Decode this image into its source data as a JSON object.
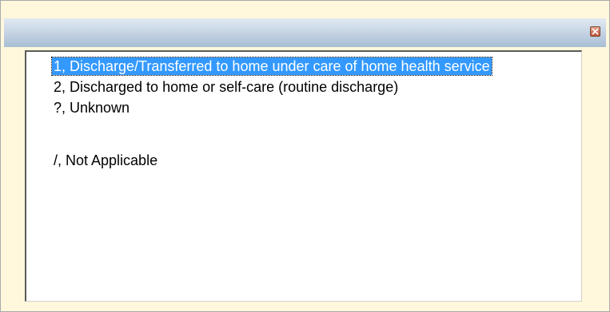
{
  "window": {
    "close_icon": "close-icon",
    "accent_color": "#3399FF",
    "background_color": "#FFF8DC"
  },
  "list": {
    "selected_index": 0,
    "items": [
      {
        "label": "1, Discharge/Transferred to home under care of home health service"
      },
      {
        "label": "2, Discharged to home or self-care (routine discharge)"
      },
      {
        "label": "?, Unknown"
      },
      {
        "label": ""
      },
      {
        "label": "/, Not Applicable"
      }
    ]
  }
}
